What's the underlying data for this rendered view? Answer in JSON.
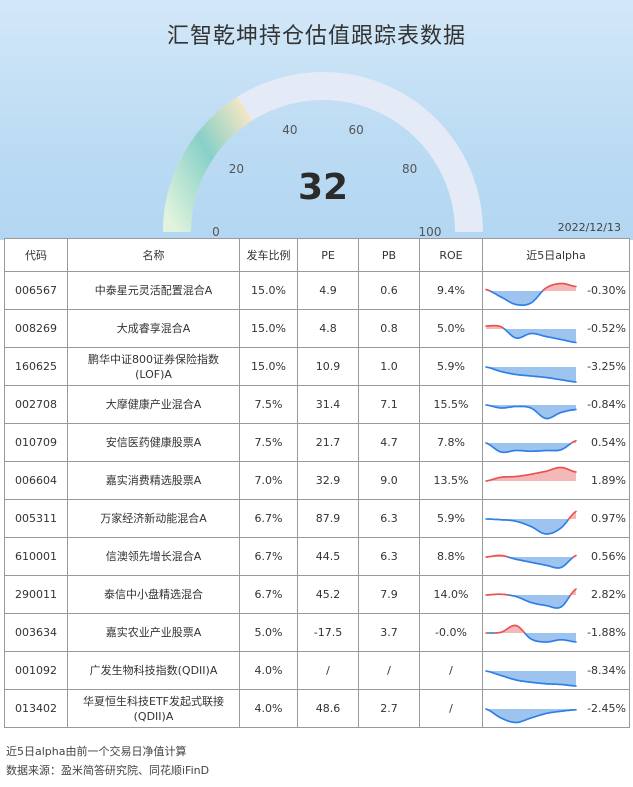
{
  "title": "汇智乾坤持仓估值跟踪表数据",
  "date": "2022/12/13",
  "gauge": {
    "value": 32,
    "value_label": "32",
    "max": 100,
    "ticks": [
      "0",
      "20",
      "40",
      "60",
      "80",
      "100"
    ],
    "colors": {
      "low": "#e0f3dc",
      "mid": "#88d0c8",
      "high": "#f3e6c4",
      "track": "#e4eaf6"
    }
  },
  "table": {
    "headers": [
      "代码",
      "名称",
      "发车比例",
      "PE",
      "PB",
      "ROE",
      "近5日alpha"
    ]
  },
  "colors": {
    "up": "#e8524f",
    "down": "#2f7fe6",
    "up_fill": "#f4b8b8",
    "down_fill": "#9cc4ee"
  },
  "chart_data": {
    "type": "table",
    "rows": [
      {
        "code": "006567",
        "name": "中泰星元灵活配置混合A",
        "ratio": "15.0%",
        "pe": "4.9",
        "pb": "0.6",
        "roe": "9.4%",
        "alpha": "-0.30%",
        "spark": [
          0.1,
          -0.4,
          -0.9,
          -0.8,
          0.2,
          0.5,
          0.3
        ]
      },
      {
        "code": "008269",
        "name": "大成睿享混合A",
        "ratio": "15.0%",
        "pe": "4.8",
        "pb": "0.8",
        "roe": "5.0%",
        "alpha": "-0.52%",
        "spark": [
          0.2,
          0.15,
          -0.6,
          -0.3,
          -0.5,
          -0.7,
          -0.9
        ]
      },
      {
        "code": "160625",
        "name": "鹏华中证800证券保险指数(LOF)A",
        "ratio": "15.0%",
        "pe": "10.9",
        "pb": "1.0",
        "roe": "5.9%",
        "alpha": "-3.25%",
        "spark": [
          0.0,
          -0.3,
          -0.5,
          -0.6,
          -0.7,
          -0.85,
          -1.0
        ]
      },
      {
        "code": "002708",
        "name": "大摩健康产业混合A",
        "ratio": "7.5%",
        "pe": "31.4",
        "pb": "7.1",
        "roe": "15.5%",
        "alpha": "-0.84%",
        "spark": [
          0.0,
          -0.2,
          -0.1,
          -0.2,
          -0.9,
          -0.5,
          -0.3
        ]
      },
      {
        "code": "010709",
        "name": "安信医药健康股票A",
        "ratio": "7.5%",
        "pe": "21.7",
        "pb": "4.7",
        "roe": "7.8%",
        "alpha": "0.54%",
        "spark": [
          0.0,
          -0.6,
          -0.5,
          -0.55,
          -0.5,
          -0.45,
          0.15
        ]
      },
      {
        "code": "006604",
        "name": "嘉实消费精选股票A",
        "ratio": "7.0%",
        "pe": "32.9",
        "pb": "9.0",
        "roe": "13.5%",
        "alpha": "1.89%",
        "spark": [
          0.0,
          0.25,
          0.3,
          0.45,
          0.65,
          0.9,
          0.6
        ]
      },
      {
        "code": "005311",
        "name": "万家经济新动能混合A",
        "ratio": "6.7%",
        "pe": "87.9",
        "pb": "6.3",
        "roe": "5.9%",
        "alpha": "0.97%",
        "spark": [
          0.0,
          -0.05,
          -0.15,
          -0.5,
          -1.0,
          -0.6,
          0.5
        ]
      },
      {
        "code": "610001",
        "name": "信澳领先增长混合A",
        "ratio": "6.7%",
        "pe": "44.5",
        "pb": "6.3",
        "roe": "8.8%",
        "alpha": "0.56%",
        "spark": [
          0.0,
          0.1,
          -0.15,
          -0.35,
          -0.55,
          -0.7,
          0.1
        ]
      },
      {
        "code": "290011",
        "name": "泰信中小盘精选混合",
        "ratio": "6.7%",
        "pe": "45.2",
        "pb": "7.9",
        "roe": "14.0%",
        "alpha": "2.82%",
        "spark": [
          0.0,
          0.05,
          -0.1,
          -0.5,
          -0.7,
          -0.8,
          0.4
        ]
      },
      {
        "code": "003634",
        "name": "嘉实农业产业股票A",
        "ratio": "5.0%",
        "pe": "-17.5",
        "pb": "3.7",
        "roe": "-0.0%",
        "alpha": "-1.88%",
        "spark": [
          0.0,
          0.05,
          0.5,
          -0.4,
          -0.6,
          -0.45,
          -0.6
        ]
      },
      {
        "code": "001092",
        "name": "广发生物科技指数(QDII)A",
        "ratio": "4.0%",
        "pe": "/",
        "pb": "/",
        "roe": "/",
        "alpha": "-8.34%",
        "spark": [
          0.0,
          -0.3,
          -0.6,
          -0.75,
          -0.85,
          -0.9,
          -1.0
        ]
      },
      {
        "code": "013402",
        "name": "华夏恒生科技ETF发起式联接(QDII)A",
        "ratio": "4.0%",
        "pe": "48.6",
        "pb": "2.7",
        "roe": "/",
        "alpha": "-2.45%",
        "spark": [
          0.0,
          -0.6,
          -0.9,
          -0.6,
          -0.3,
          -0.15,
          -0.05
        ]
      }
    ]
  },
  "footnote": [
    "近5日alpha由前一个交易日净值计算",
    "数据来源：盈米简答研究院、同花顺iFinD"
  ]
}
